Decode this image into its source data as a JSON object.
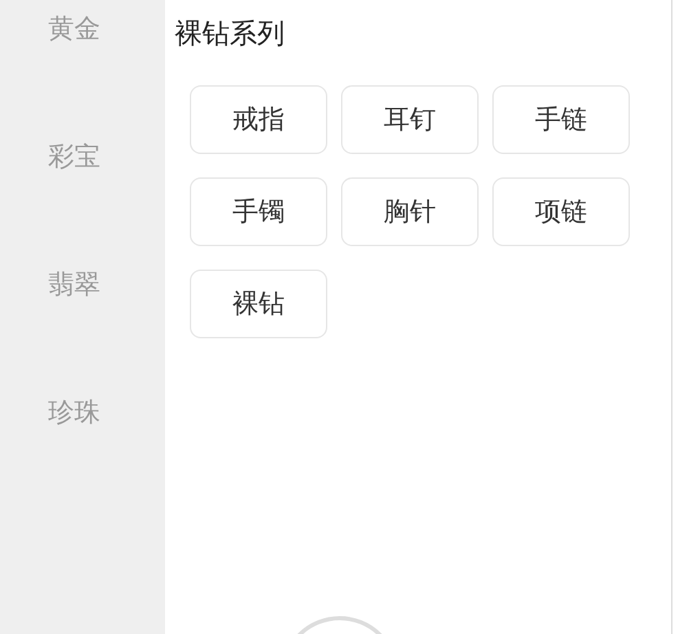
{
  "sidebar": {
    "items": [
      "黄金",
      "彩宝",
      "翡翠",
      "珍珠"
    ]
  },
  "section": {
    "title": "裸钻系列",
    "items": [
      "戒指",
      "耳钉",
      "手链",
      "手镯",
      "胸针",
      "项链",
      "裸钻"
    ]
  }
}
